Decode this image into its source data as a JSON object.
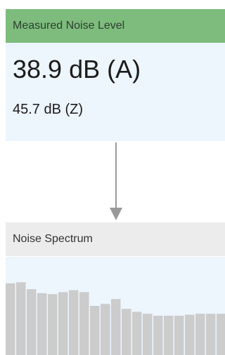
{
  "level_panel": {
    "title": "Measured Noise Level",
    "dba": "38.9  dB (A)",
    "dbz": "45.7  dB (Z)",
    "header_color": "#7dbc7d",
    "body_color": "#edf5fd"
  },
  "connector": {
    "icon": "arrow-down-icon",
    "color": "#999999"
  },
  "spectrum_panel": {
    "title": "Noise Spectrum",
    "header_color": "#ececec",
    "bar_color": "#cccccc"
  },
  "chart_data": {
    "type": "bar",
    "bar_levels": [
      0.73,
      0.74,
      0.67,
      0.63,
      0.62,
      0.64,
      0.66,
      0.64,
      0.5,
      0.52,
      0.57,
      0.47,
      0.44,
      0.42,
      0.4,
      0.4,
      0.4,
      0.41,
      0.42,
      0.42,
      0.42
    ]
  }
}
